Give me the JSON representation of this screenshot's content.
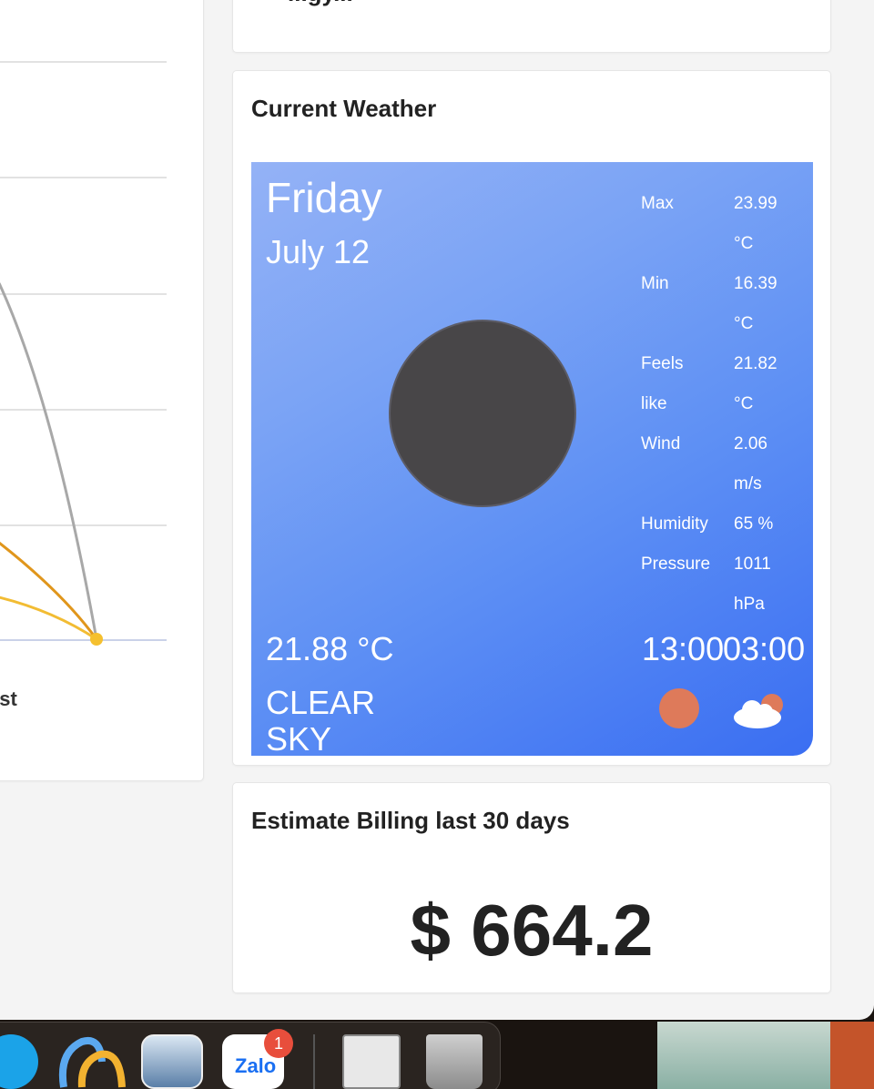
{
  "top_card": {
    "title_fragment": "...gy..."
  },
  "chart_card": {
    "legend_fragment": "est"
  },
  "weather": {
    "title": "Current Weather",
    "day": "Friday",
    "date": "July 12",
    "stats": [
      {
        "label": "Max",
        "value": "23.99",
        "unit": "°C"
      },
      {
        "label": "Min",
        "value": "16.39",
        "unit": "°C"
      },
      {
        "label": "Feels",
        "label2": "like",
        "value": "21.82",
        "unit": "°C"
      },
      {
        "label": "Wind",
        "value": "2.06",
        "unit": "m/s"
      },
      {
        "label": "Humidity",
        "value": "65 %"
      },
      {
        "label": "Pressure",
        "value": "1011",
        "unit": "hPa"
      }
    ],
    "temperature": "21.88 °C",
    "condition_line1": "CLEAR",
    "condition_line2": "SKY",
    "sunrise": "13:00",
    "sunset": "03:00",
    "sun_color": "#484648",
    "gradient_colors": [
      "#94b2f6",
      "#3a6ef2"
    ]
  },
  "billing": {
    "title": "Estimate Billing last 30 days",
    "amount": "$ 664.2"
  },
  "dock": {
    "items": [
      "skype-icon",
      "copilot-icon",
      "preview-icon",
      "zalo-icon",
      "image-capture-icon",
      "trash-icon"
    ],
    "zalo_label": "Zalo",
    "zalo_badge": "1"
  }
}
